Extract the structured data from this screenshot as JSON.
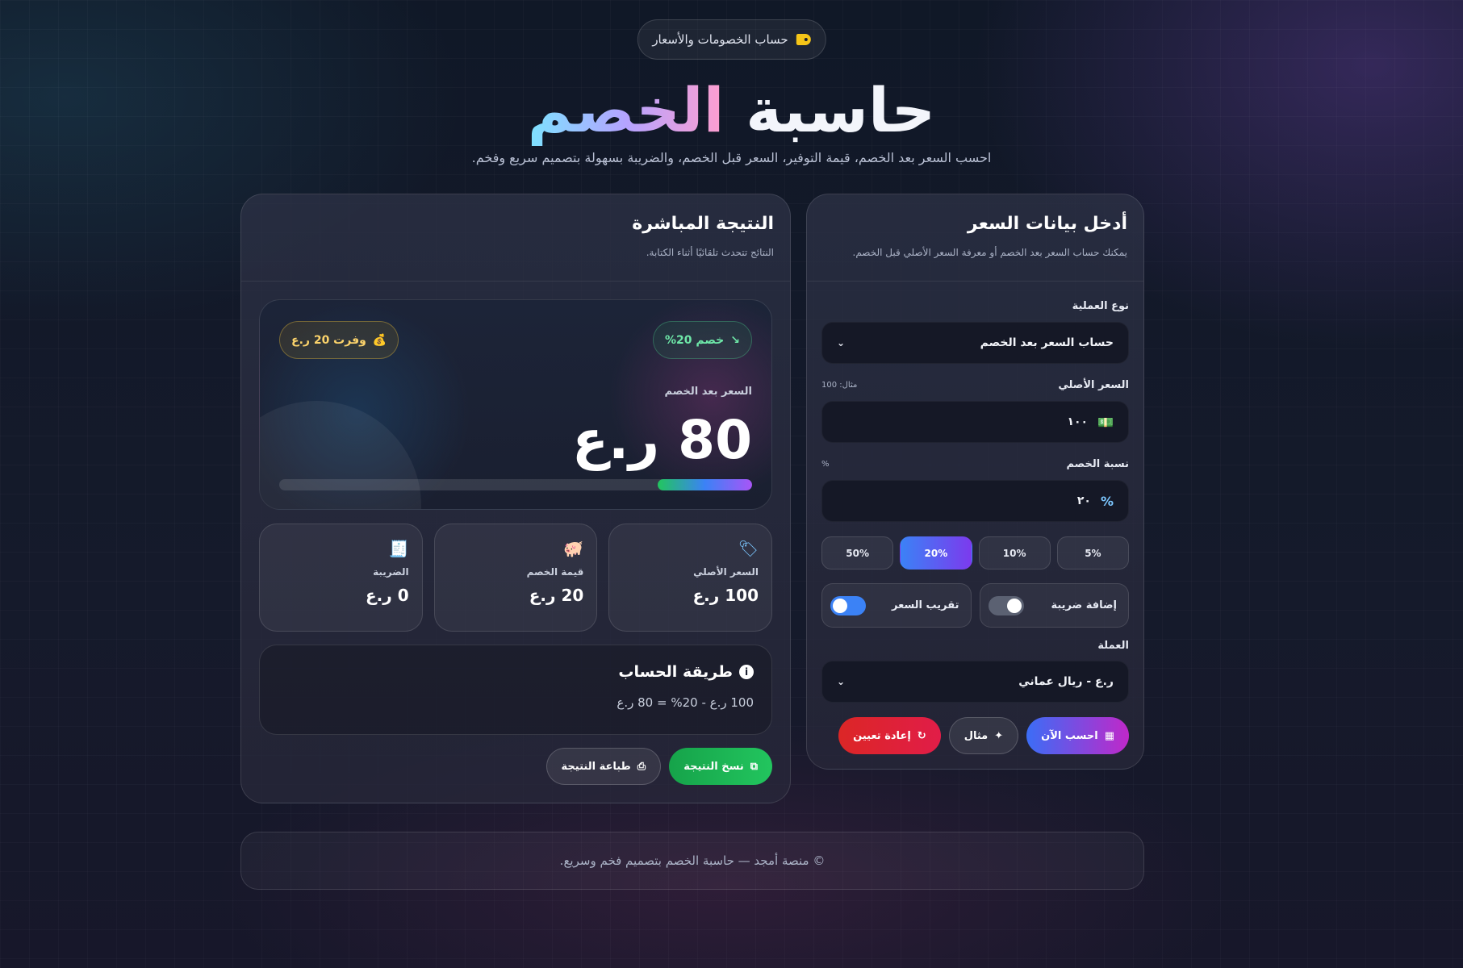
{
  "badge": {
    "label": "حساب الخصومات والأسعار",
    "icon": "tag-icon"
  },
  "hero": {
    "word1": "حاسبة",
    "word2": "الخصم"
  },
  "subtitle": "احسب السعر بعد الخصم، قيمة التوفير، السعر قبل الخصم، والضريبة بسهولة بتصميم سريع وفخم.",
  "input_card": {
    "title": "أدخل بيانات السعر",
    "desc": "يمكنك حساب السعر بعد الخصم أو معرفة السعر الأصلي قبل الخصم.",
    "operation_label": "نوع العملية",
    "operation_value": "حساب السعر بعد الخصم",
    "price_label": "السعر الأصلي",
    "price_hint": "مثال: 100",
    "price_value": "١٠٠",
    "discount_label": "نسبة الخصم",
    "discount_hint": "%",
    "discount_value": "٢٠",
    "presets": [
      "5%",
      "10%",
      "20%",
      "50%"
    ],
    "active_preset": "20%",
    "tax_toggle": {
      "label": "إضافة ضريبة",
      "on": false
    },
    "round_toggle": {
      "label": "تقريب السعر",
      "on": true
    },
    "currency_label": "العملة",
    "currency_value": "ر.ع - ريال عماني",
    "buttons": {
      "calc": "احسب الآن",
      "example": "مثال",
      "reset": "إعادة تعيين"
    }
  },
  "result_card": {
    "title": "النتيجة المباشرة",
    "desc": "النتائج تتحدث تلقائيًا أثناء الكتابة.",
    "discount_chip": "خصم 20%",
    "saved_chip": "وفرت 20 ر.ع",
    "final_label": "السعر بعد الخصم",
    "final_value": "80 ر.ع",
    "progress_fraction": 0.2,
    "stats": [
      {
        "label": "السعر الأصلي",
        "value": "100 ر.ع",
        "icon": "tag-icon"
      },
      {
        "label": "قيمة الخصم",
        "value": "20 ر.ع",
        "icon": "piggy-bank-icon"
      },
      {
        "label": "الضريبة",
        "value": "0 ر.ع",
        "icon": "receipt-icon"
      }
    ],
    "method_title": "طريقة الحساب",
    "method_formula": "100 ر.ع - 20% = 80 ر.ع",
    "buttons": {
      "copy": "نسخ النتيجة",
      "print": "طباعة النتيجة"
    }
  },
  "footer": "© منصة أمجد — حاسبة الخصم بتصميم فخم وسريع.",
  "colors": {
    "accent_blue": "#3b82f6",
    "accent_purple": "#7c3aed",
    "success": "#22c55e",
    "danger": "#dc2626",
    "gold": "#fbd36b"
  }
}
